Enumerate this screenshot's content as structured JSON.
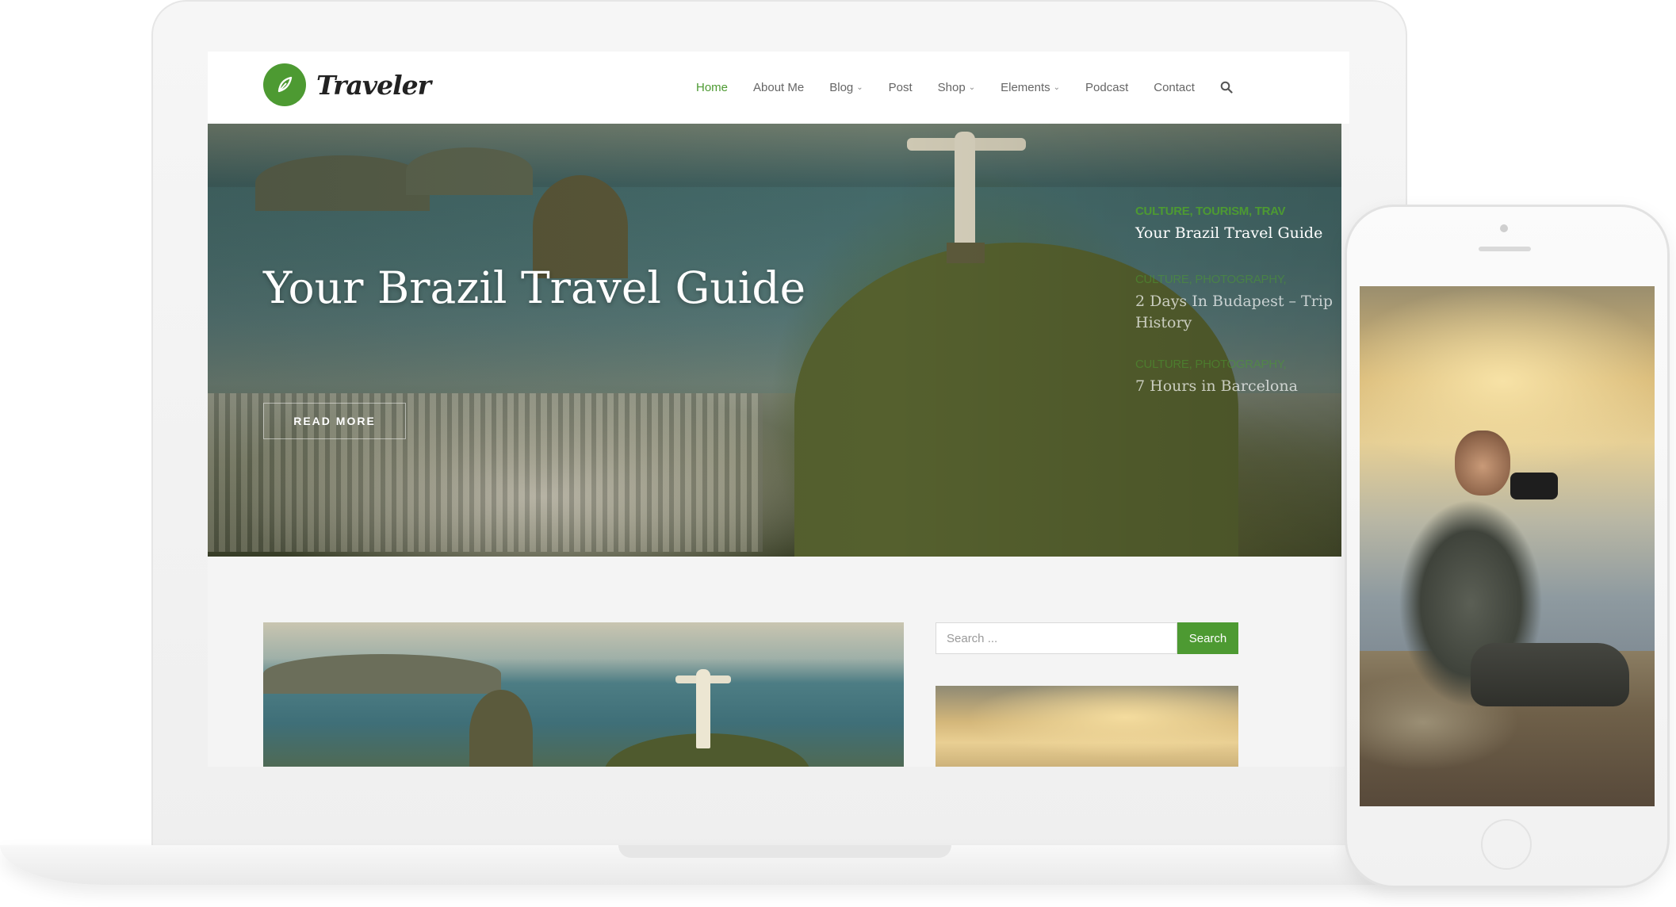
{
  "brand": {
    "name": "Traveler",
    "accent_color": "#4d9a32",
    "logo_icon": "compass-leaf-icon"
  },
  "nav": {
    "items": [
      {
        "label": "Home",
        "active": true,
        "dropdown": false
      },
      {
        "label": "About Me",
        "active": false,
        "dropdown": false
      },
      {
        "label": "Blog",
        "active": false,
        "dropdown": true
      },
      {
        "label": "Post",
        "active": false,
        "dropdown": false
      },
      {
        "label": "Shop",
        "active": false,
        "dropdown": true
      },
      {
        "label": "Elements",
        "active": false,
        "dropdown": true
      },
      {
        "label": "Podcast",
        "active": false,
        "dropdown": false
      },
      {
        "label": "Contact",
        "active": false,
        "dropdown": false
      }
    ],
    "search_icon": "search-icon"
  },
  "hero": {
    "title": "Your Brazil Travel Guide",
    "button_label": "READ MORE",
    "slides": [
      {
        "categories": "CULTURE, TOURISM, TRAV",
        "title": "Your Brazil Travel Guide",
        "active": true
      },
      {
        "categories": "CULTURE, PHOTOGRAPHY,",
        "title": "2 Days In Budapest – Trip History",
        "active": false
      },
      {
        "categories": "CULTURE, PHOTOGRAPHY,",
        "title": "7 Hours in Barcelona",
        "active": false
      }
    ]
  },
  "sidebar": {
    "search_placeholder": "Search ...",
    "search_button": "Search"
  }
}
